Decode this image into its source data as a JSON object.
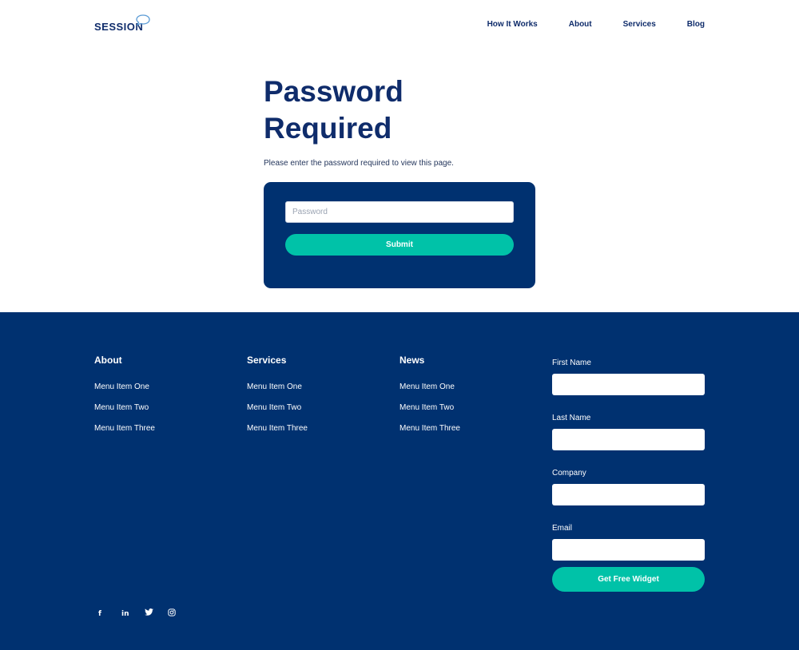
{
  "header": {
    "logo_text": "SESSION",
    "nav": [
      "How It Works",
      "About",
      "Services",
      "Blog"
    ]
  },
  "main": {
    "title_line1": "Password",
    "title_line2": "Required",
    "subtitle": "Please enter the password required to view this page.",
    "password_placeholder": "Password",
    "submit_label": "Submit"
  },
  "footer": {
    "columns": [
      {
        "title": "About",
        "items": [
          "Menu Item One",
          "Menu Item Two",
          "Menu Item Three"
        ]
      },
      {
        "title": "Services",
        "items": [
          "Menu Item One",
          "Menu Item Two",
          "Menu Item Three"
        ]
      },
      {
        "title": "News",
        "items": [
          "Menu Item One",
          "Menu Item Two",
          "Menu Item Three"
        ]
      }
    ],
    "form": {
      "fields": [
        "First Name",
        "Last Name",
        "Company",
        "Email"
      ],
      "button_label": "Get Free Widget"
    },
    "social": [
      {
        "icon": "facebook-icon",
        "glyph": "f"
      },
      {
        "icon": "linkedin-icon",
        "glyph": "in"
      },
      {
        "icon": "twitter-icon",
        "glyph": "🐦"
      },
      {
        "icon": "instagram-icon",
        "glyph": "◎"
      }
    ]
  },
  "colors": {
    "navy": "#003170",
    "teal": "#00c2a8",
    "heading": "#0f2c6b"
  }
}
